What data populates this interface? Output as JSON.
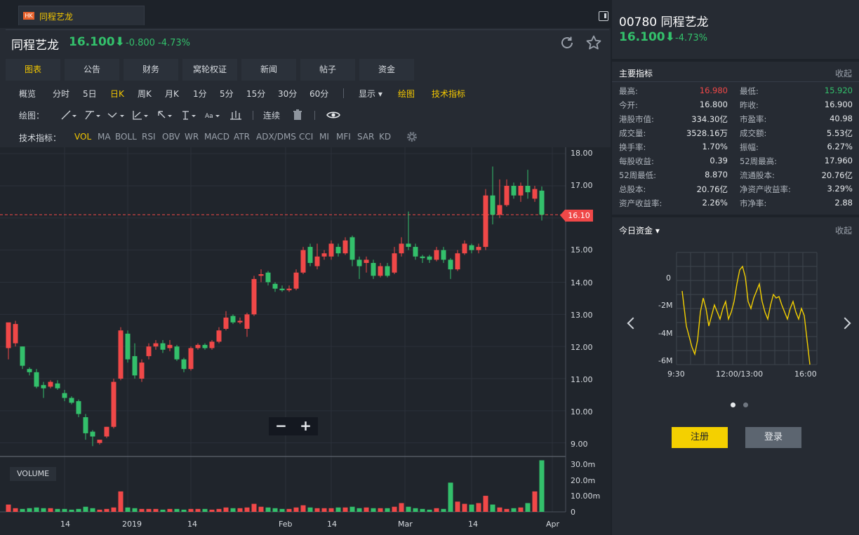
{
  "tab": {
    "badge": "HK",
    "label": "同程艺龙"
  },
  "quote": {
    "name": "同程艺龙",
    "price": "16.100",
    "change": "-0.800",
    "change_pct": "-4.73%"
  },
  "main_tabs": [
    "图表",
    "公告",
    "财务",
    "窝轮权证",
    "新闻",
    "帖子",
    "资金"
  ],
  "periods": [
    "概览",
    "分时",
    "5日",
    "日K",
    "周K",
    "月K",
    "1分",
    "5分",
    "15分",
    "30分",
    "60分"
  ],
  "period_active": "日K",
  "toolbar_right": {
    "display": "显示",
    "draw": "绘图",
    "indicators": "技术指标"
  },
  "drawing": {
    "label": "绘图：",
    "continuous": "连续"
  },
  "indicators": {
    "label": "技术指标：",
    "items": [
      "VOL",
      "MA",
      "BOLL",
      "RSI",
      "OBV",
      "WR",
      "MACD",
      "ATR",
      "ADX/DMS",
      "CCI",
      "MI",
      "MFI",
      "SAR",
      "KD"
    ],
    "active": "VOL"
  },
  "price_axis": [
    "18.00",
    "17.00",
    "16.00",
    "15.00",
    "14.00",
    "13.00",
    "12.00",
    "11.00",
    "10.00",
    "9.00"
  ],
  "current_price_tag": "16.10",
  "volume_axis": [
    "30.0m",
    "20.0m",
    "10.00m",
    "0"
  ],
  "volume_label": "VOLUME",
  "date_axis": [
    "14",
    "2019",
    "14",
    "Feb",
    "14",
    "Mar",
    "14",
    "Apr"
  ],
  "zoom": {
    "minus": "−",
    "plus": "+"
  },
  "colors": {
    "up": "#f04848",
    "down": "#33c06b",
    "accent": "#f4c800",
    "intraday": "#f4d000"
  },
  "chart_data": {
    "type": "candlestick",
    "ylim": [
      8.6,
      18.2
    ],
    "price_unit": "HKD",
    "candles": [
      [
        11.95,
        12.75,
        12.4,
        11.6,
        12.55
      ],
      [
        12.1,
        12.7,
        12.8,
        12.0,
        12.0
      ],
      [
        12.0,
        11.4,
        12.0,
        11.3,
        11.3
      ],
      [
        11.3,
        11.2,
        11.35,
        11.1,
        11.1
      ],
      [
        11.2,
        10.75,
        11.3,
        10.7,
        10.75
      ],
      [
        10.8,
        10.7,
        10.9,
        10.4,
        10.7
      ],
      [
        10.75,
        10.9,
        10.95,
        10.7,
        10.9
      ],
      [
        10.85,
        10.7,
        10.95,
        10.65,
        10.7
      ],
      [
        10.55,
        10.4,
        10.65,
        10.3,
        10.35
      ],
      [
        10.4,
        10.25,
        10.45,
        10.2,
        10.3
      ],
      [
        10.3,
        9.9,
        10.35,
        9.8,
        9.85
      ],
      [
        9.8,
        9.3,
        9.9,
        9.1,
        9.3
      ],
      [
        9.35,
        9.2,
        9.4,
        8.9,
        9.2
      ],
      [
        9.0,
        9.1,
        9.1,
        8.95,
        9.05
      ],
      [
        9.2,
        9.5,
        9.5,
        9.15,
        9.25
      ],
      [
        9.5,
        10.9,
        11.0,
        9.45,
        10.85
      ],
      [
        11.0,
        12.5,
        12.6,
        10.95,
        12.45
      ],
      [
        12.4,
        11.6,
        12.5,
        11.5,
        11.6
      ],
      [
        11.7,
        11.1,
        12.1,
        11.0,
        11.1
      ],
      [
        11.0,
        11.5,
        11.6,
        10.9,
        11.45
      ],
      [
        11.7,
        12.0,
        12.1,
        11.6,
        12.0
      ],
      [
        12.0,
        12.1,
        12.2,
        11.9,
        12.1
      ],
      [
        12.1,
        11.9,
        12.2,
        11.8,
        11.9
      ],
      [
        11.95,
        12.05,
        12.2,
        11.85,
        12.05
      ],
      [
        12.0,
        11.6,
        12.05,
        11.55,
        11.6
      ],
      [
        11.6,
        11.3,
        11.65,
        11.2,
        11.3
      ],
      [
        11.3,
        11.95,
        12.0,
        11.25,
        11.95
      ],
      [
        11.95,
        12.05,
        12.1,
        11.9,
        12.05
      ],
      [
        12.05,
        11.95,
        12.1,
        11.9,
        11.95
      ],
      [
        11.95,
        12.15,
        12.2,
        11.9,
        12.15
      ],
      [
        12.15,
        12.5,
        12.6,
        12.1,
        12.5
      ],
      [
        12.55,
        12.9,
        13.1,
        12.5,
        12.9
      ],
      [
        12.95,
        12.75,
        13.0,
        12.7,
        12.75
      ],
      [
        12.75,
        12.8,
        12.9,
        12.7,
        12.8
      ],
      [
        12.55,
        13.0,
        13.05,
        12.3,
        12.55
      ],
      [
        13.0,
        14.1,
        14.2,
        12.95,
        14.1
      ],
      [
        14.2,
        14.25,
        14.4,
        14.0,
        14.2
      ],
      [
        14.3,
        14.0,
        14.35,
        13.9,
        14.0
      ],
      [
        13.95,
        13.8,
        14.0,
        13.7,
        13.8
      ],
      [
        13.8,
        13.75,
        13.9,
        13.7,
        13.75
      ],
      [
        13.75,
        13.8,
        13.9,
        13.7,
        13.8
      ],
      [
        13.8,
        14.3,
        14.4,
        13.75,
        14.3
      ],
      [
        14.3,
        15.0,
        15.1,
        14.25,
        15.0
      ],
      [
        15.1,
        14.6,
        15.2,
        14.5,
        14.6
      ],
      [
        14.5,
        14.8,
        15.2,
        14.4,
        14.8
      ],
      [
        14.8,
        14.9,
        15.0,
        14.7,
        14.9
      ],
      [
        14.8,
        15.2,
        15.3,
        14.7,
        14.8
      ],
      [
        15.1,
        14.9,
        15.2,
        14.8,
        14.9
      ],
      [
        14.9,
        15.3,
        15.4,
        14.85,
        15.3
      ],
      [
        15.4,
        14.7,
        15.45,
        14.5,
        14.7
      ],
      [
        14.7,
        14.5,
        14.8,
        14.1,
        14.5
      ],
      [
        14.6,
        14.7,
        14.8,
        14.3,
        14.7
      ],
      [
        14.6,
        14.2,
        14.7,
        14.1,
        14.2
      ],
      [
        14.2,
        14.5,
        14.6,
        14.15,
        14.5
      ],
      [
        14.5,
        14.2,
        14.6,
        14.15,
        14.2
      ],
      [
        14.3,
        14.9,
        15.1,
        14.25,
        14.9
      ],
      [
        14.9,
        15.2,
        15.4,
        14.8,
        15.2
      ],
      [
        15.2,
        15.1,
        16.2,
        15.0,
        15.1
      ],
      [
        15.1,
        14.8,
        15.2,
        14.7,
        14.8
      ],
      [
        14.8,
        14.75,
        14.85,
        14.6,
        14.75
      ],
      [
        14.8,
        14.7,
        14.85,
        14.6,
        14.7
      ],
      [
        14.7,
        15.0,
        15.1,
        14.65,
        15.0
      ],
      [
        15.0,
        14.7,
        15.1,
        14.6,
        14.7
      ],
      [
        14.7,
        14.4,
        14.75,
        14.1,
        14.4
      ],
      [
        14.4,
        14.9,
        15.0,
        14.35,
        14.9
      ],
      [
        14.9,
        15.2,
        15.3,
        14.85,
        15.2
      ],
      [
        15.15,
        15.0,
        15.2,
        14.9,
        15.0
      ],
      [
        15.0,
        15.1,
        15.2,
        14.9,
        15.1
      ],
      [
        15.1,
        16.7,
        16.9,
        15.0,
        16.7
      ],
      [
        16.7,
        16.1,
        17.6,
        15.8,
        16.1
      ],
      [
        16.1,
        16.4,
        17.2,
        16.0,
        16.4
      ],
      [
        16.4,
        17.0,
        17.2,
        16.35,
        17.0
      ],
      [
        17.0,
        16.7,
        17.1,
        16.6,
        16.7
      ],
      [
        16.7,
        17.0,
        17.1,
        16.5,
        17.0
      ],
      [
        17.0,
        16.8,
        17.5,
        16.6,
        16.8
      ],
      [
        16.6,
        16.9,
        17.0,
        16.5,
        16.6
      ],
      [
        16.85,
        16.1,
        16.98,
        15.92,
        16.1
      ]
    ],
    "volume": [
      5.0,
      2.5,
      2.0,
      2.5,
      3.0,
      2.5,
      2.5,
      2.0,
      2.0,
      1.5,
      2.0,
      3.5,
      2.5,
      1.5,
      2.0,
      3.0,
      14.0,
      3.0,
      2.5,
      2.0,
      2.0,
      2.0,
      1.5,
      2.0,
      2.0,
      1.5,
      2.0,
      2.0,
      2.0,
      1.5,
      2.0,
      3.0,
      2.5,
      2.5,
      3.0,
      5.5,
      3.5,
      3.0,
      2.5,
      2.0,
      2.0,
      3.0,
      4.5,
      3.0,
      2.5,
      2.5,
      2.5,
      3.0,
      3.0,
      3.5,
      2.5,
      3.0,
      2.5,
      2.5,
      2.5,
      3.5,
      6.0,
      3.5,
      2.5,
      2.0,
      1.5,
      2.5,
      2.0,
      20.0,
      7.0,
      5.5,
      5.0,
      6.0,
      11.0,
      5.0,
      3.0,
      2.0,
      2.5,
      3.0,
      6.0,
      14.0,
      35.3
    ]
  },
  "right": {
    "code_name": "00780 同程艺龙",
    "price": "16.100",
    "change_pct": "-4.73%",
    "indicators_title": "主要指标",
    "collapse": "收起",
    "stats": [
      [
        "最高:",
        "16.980",
        "最低:",
        "15.920"
      ],
      [
        "今开:",
        "16.800",
        "昨收:",
        "16.900"
      ],
      [
        "港股市值:",
        "334.30亿",
        "市盈率:",
        "40.98"
      ],
      [
        "成交量:",
        "3528.16万",
        "成交额:",
        "5.53亿"
      ],
      [
        "换手率:",
        "1.70%",
        "振幅:",
        "6.27%"
      ],
      [
        "每股收益:",
        "0.39",
        "52周最高:",
        "17.960"
      ],
      [
        "52周最低:",
        "8.870",
        "流通股本:",
        "20.76亿"
      ],
      [
        "总股本:",
        "20.76亿",
        "净资产收益率:",
        "3.29%"
      ],
      [
        "资产收益率:",
        "2.26%",
        "市净率:",
        "2.88"
      ]
    ],
    "funds_title": "今日资金",
    "funds_y": [
      "0",
      "-2M",
      "-4M",
      "-6M"
    ],
    "funds_x": [
      "9:30",
      "12:00/13:00",
      "16:00"
    ],
    "register": "注册",
    "login": "登录"
  }
}
